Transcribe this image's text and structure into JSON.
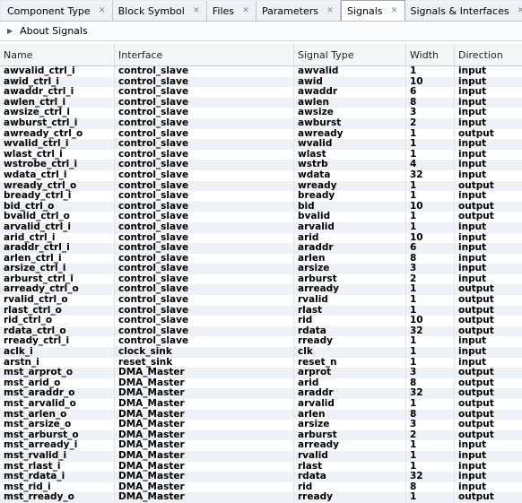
{
  "tabs": [
    {
      "label": "Component Type",
      "active": false
    },
    {
      "label": "Block Symbol",
      "active": false
    },
    {
      "label": "Files",
      "active": false
    },
    {
      "label": "Parameters",
      "active": false
    },
    {
      "label": "Signals",
      "active": true
    },
    {
      "label": "Signals & Interfaces",
      "active": false
    }
  ],
  "about_label": "About Signals",
  "columns": [
    "Name",
    "Interface",
    "Signal Type",
    "Width",
    "Direction"
  ],
  "rows": [
    [
      "awvalid_ctrl_i",
      "control_slave",
      "awvalid",
      "1",
      "input"
    ],
    [
      "awid_ctrl_i",
      "control_slave",
      "awid",
      "10",
      "input"
    ],
    [
      "awaddr_ctrl_i",
      "control_slave",
      "awaddr",
      "6",
      "input"
    ],
    [
      "awlen_ctrl_i",
      "control_slave",
      "awlen",
      "8",
      "input"
    ],
    [
      "awsize_ctrl_i",
      "control_slave",
      "awsize",
      "3",
      "input"
    ],
    [
      "awburst_ctrl_i",
      "control_slave",
      "awburst",
      "2",
      "input"
    ],
    [
      "awready_ctrl_o",
      "control_slave",
      "awready",
      "1",
      "output"
    ],
    [
      "wvalid_ctrl_i",
      "control_slave",
      "wvalid",
      "1",
      "input"
    ],
    [
      "wlast_ctrl_i",
      "control_slave",
      "wlast",
      "1",
      "input"
    ],
    [
      "wstrobe_ctrl_i",
      "control_slave",
      "wstrb",
      "4",
      "input"
    ],
    [
      "wdata_ctrl_i",
      "control_slave",
      "wdata",
      "32",
      "input"
    ],
    [
      "wready_ctrl_o",
      "control_slave",
      "wready",
      "1",
      "output"
    ],
    [
      "bready_ctrl_i",
      "control_slave",
      "bready",
      "1",
      "input"
    ],
    [
      "bid_ctrl_o",
      "control_slave",
      "bid",
      "10",
      "output"
    ],
    [
      "bvalid_ctrl_o",
      "control_slave",
      "bvalid",
      "1",
      "output"
    ],
    [
      "arvalid_ctrl_i",
      "control_slave",
      "arvalid",
      "1",
      "input"
    ],
    [
      "arid_ctrl_i",
      "control_slave",
      "arid",
      "10",
      "input"
    ],
    [
      "araddr_ctrl_i",
      "control_slave",
      "araddr",
      "6",
      "input"
    ],
    [
      "arlen_ctrl_i",
      "control_slave",
      "arlen",
      "8",
      "input"
    ],
    [
      "arsize_ctrl_i",
      "control_slave",
      "arsize",
      "3",
      "input"
    ],
    [
      "arburst_ctrl_i",
      "control_slave",
      "arburst",
      "2",
      "input"
    ],
    [
      "arready_ctrl_o",
      "control_slave",
      "arready",
      "1",
      "output"
    ],
    [
      "rvalid_ctrl_o",
      "control_slave",
      "rvalid",
      "1",
      "output"
    ],
    [
      "rlast_ctrl_o",
      "control_slave",
      "rlast",
      "1",
      "output"
    ],
    [
      "rid_ctrl_o",
      "control_slave",
      "rid",
      "10",
      "output"
    ],
    [
      "rdata_ctrl_o",
      "control_slave",
      "rdata",
      "32",
      "output"
    ],
    [
      "rready_ctrl_i",
      "control_slave",
      "rready",
      "1",
      "input"
    ],
    [
      "aclk_i",
      "clock_sink",
      "clk",
      "1",
      "input"
    ],
    [
      "arstn_i",
      "reset_sink",
      "reset_n",
      "1",
      "input"
    ],
    [
      "mst_arprot_o",
      "DMA_Master",
      "arprot",
      "3",
      "output"
    ],
    [
      "mst_arid_o",
      "DMA_Master",
      "arid",
      "8",
      "output"
    ],
    [
      "mst_araddr_o",
      "DMA_Master",
      "araddr",
      "32",
      "output"
    ],
    [
      "mst_arvalid_o",
      "DMA_Master",
      "arvalid",
      "1",
      "output"
    ],
    [
      "mst_arlen_o",
      "DMA_Master",
      "arlen",
      "8",
      "output"
    ],
    [
      "mst_arsize_o",
      "DMA_Master",
      "arsize",
      "3",
      "output"
    ],
    [
      "mst_arburst_o",
      "DMA_Master",
      "arburst",
      "2",
      "output"
    ],
    [
      "mst_arready_i",
      "DMA_Master",
      "arready",
      "1",
      "input"
    ],
    [
      "mst_rvalid_i",
      "DMA_Master",
      "rvalid",
      "1",
      "input"
    ],
    [
      "mst_rlast_i",
      "DMA_Master",
      "rlast",
      "1",
      "input"
    ],
    [
      "mst_rdata_i",
      "DMA_Master",
      "rdata",
      "32",
      "input"
    ],
    [
      "mst_rid_i",
      "DMA_Master",
      "rid",
      "8",
      "input"
    ],
    [
      "mst_rready_o",
      "DMA_Master",
      "rready",
      "1",
      "output"
    ]
  ]
}
